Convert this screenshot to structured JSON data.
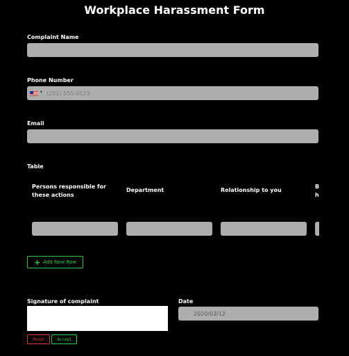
{
  "form": {
    "title": "Workplace Harassment Form",
    "complaint_name_label": "Complaint Name",
    "phone_label": "Phone Number",
    "phone_placeholder": "(201) 555-0123",
    "email_label": "Email",
    "table_label": "Table",
    "table_headers": [
      "Persons responsible for these actions",
      "Department",
      "Relationship to you",
      "B h"
    ],
    "add_row_label": "Add New Row",
    "signature_label": "Signature of complaint",
    "reset_label": "Reset",
    "accept_label": "Accept",
    "date_label": "Date",
    "date_value": "2020/03/12"
  },
  "icons": {
    "country_flag": "us-flag-icon",
    "dropdown": "caret-down-icon",
    "add": "plus-icon"
  },
  "colors": {
    "background": "#000000",
    "field": "#aeaeae",
    "accent_green": "#2ecc40",
    "accent_red": "#e53935"
  }
}
